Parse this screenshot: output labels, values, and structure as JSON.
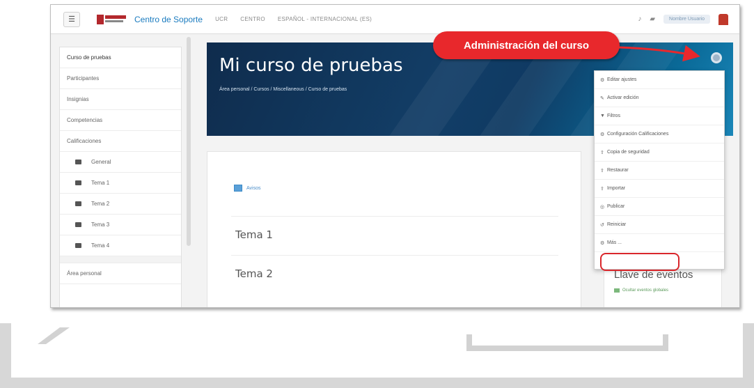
{
  "navbar": {
    "menu_icon": "hamburger-icon",
    "site_name": "Centro de Soporte",
    "links": [
      "UCR",
      "CENTRO",
      "ESPAÑOL - INTERNACIONAL (ES)"
    ],
    "user_name": "Nombre Usuario"
  },
  "sidebar": {
    "items": [
      {
        "label": "Curso de pruebas",
        "folder": false
      },
      {
        "label": "Participantes",
        "folder": false
      },
      {
        "label": "Insignias",
        "folder": false
      },
      {
        "label": "Competencias",
        "folder": false
      },
      {
        "label": "Calificaciones",
        "folder": false
      },
      {
        "label": "General",
        "folder": true
      },
      {
        "label": "Tema 1",
        "folder": true
      },
      {
        "label": "Tema 2",
        "folder": true
      },
      {
        "label": "Tema 3",
        "folder": true
      },
      {
        "label": "Tema 4",
        "folder": true
      }
    ],
    "bottom_item": "Área personal"
  },
  "header": {
    "course_title": "Mi curso de pruebas",
    "breadcrumb": "Área personal / Cursos / Miscellaneous / Curso de pruebas"
  },
  "content": {
    "notice_label": "Avisos",
    "topics": [
      "Tema 1",
      "Tema 2"
    ]
  },
  "dropdown": {
    "items": [
      {
        "icon": "⚙",
        "label": "Editar ajustes"
      },
      {
        "icon": "✎",
        "label": "Activar edición"
      },
      {
        "icon": "▼",
        "label": "Filtros"
      },
      {
        "icon": "⚙",
        "label": "Configuración Calificaciones"
      },
      {
        "icon": "⇪",
        "label": "Copia de seguridad"
      },
      {
        "icon": "⇪",
        "label": "Restaurar"
      },
      {
        "icon": "⇪",
        "label": "Importar"
      },
      {
        "icon": "◎",
        "label": "Publicar"
      },
      {
        "icon": "↺",
        "label": "Reiniciar"
      },
      {
        "icon": "⚙",
        "label": "Más ..."
      }
    ]
  },
  "events": {
    "title": "Llave de eventos",
    "link": "Ocultar eventos globales"
  },
  "callout": {
    "text": "Administración del curso"
  },
  "colors": {
    "callout_red": "#e8282c",
    "banner_dark": "#123e67",
    "link_blue": "#1a7bbf"
  }
}
